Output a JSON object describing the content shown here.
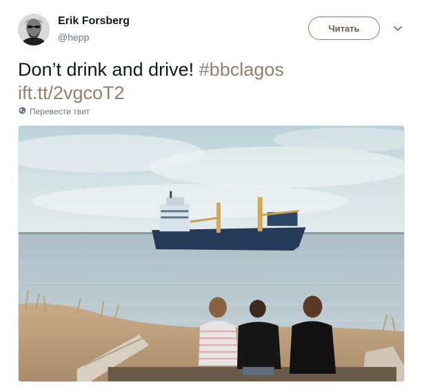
{
  "author": {
    "name": "Erik Forsberg",
    "handle": "@hepp"
  },
  "follow_button": {
    "label": "Читать"
  },
  "icons": {
    "caret": "chevron-down-icon",
    "translate": "globe-icon"
  },
  "tweet": {
    "text_before": "Don’t drink and drive!",
    "hashtag": "#bbclagos",
    "link": "ift.tt/2vgcoT2"
  },
  "translate_label": "Перевести твит",
  "colors": {
    "accent": "#91806e",
    "button_border": "#8a7a6a",
    "secondary_text": "#657786"
  }
}
